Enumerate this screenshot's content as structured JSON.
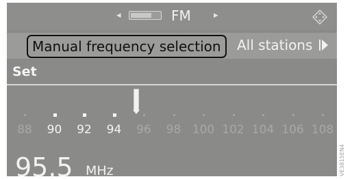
{
  "header": {
    "band_label": "FM",
    "left_arrow": "◂",
    "right_arrow": "▸"
  },
  "tabs": {
    "manual_label": "Manual frequency selection",
    "all_stations_label": "All stations"
  },
  "set_label": "Set",
  "scale": {
    "labels": [
      "88",
      "90",
      "92",
      "94",
      "96",
      "98",
      "100",
      "102",
      "104",
      "106",
      "108"
    ],
    "active_labels": [
      "90",
      "92",
      "94"
    ],
    "tuned_frequency_mhz": 95.5
  },
  "readout": {
    "value": "95.5",
    "unit": "MHz"
  },
  "watermark": "VE3815EN4",
  "colors": {
    "screen_bg": "#8a8a88",
    "text": "#f2f2f2",
    "dim_text": "#a8a8a6",
    "selection_border": "#111111"
  }
}
